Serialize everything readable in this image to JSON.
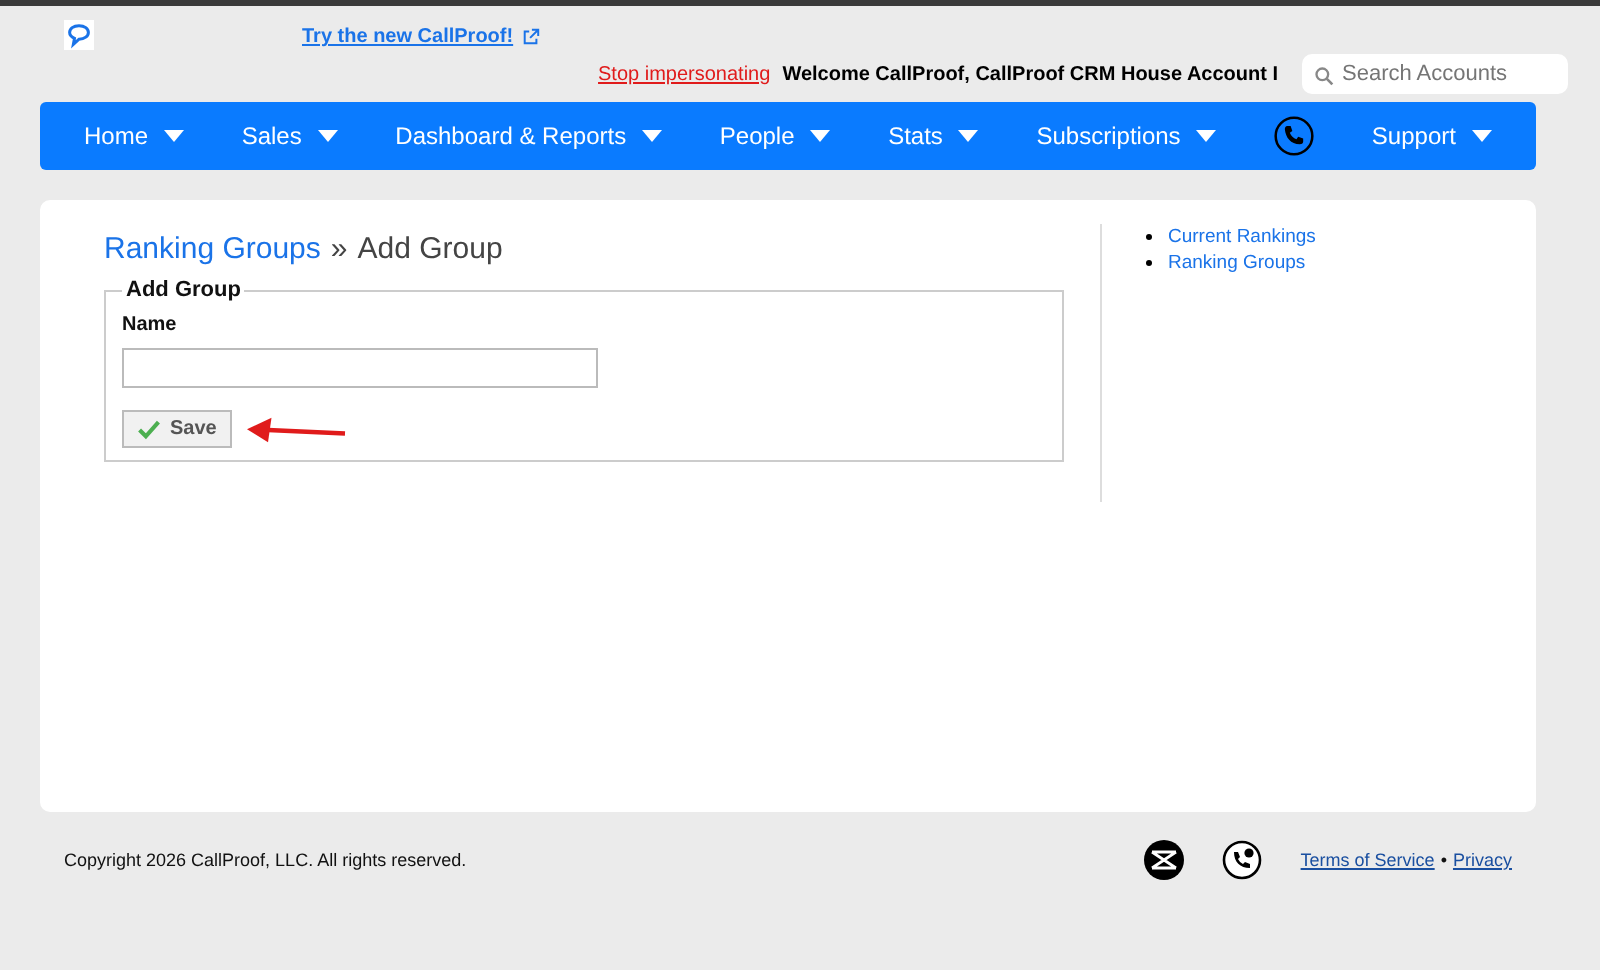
{
  "header": {
    "promo_link": "Try the new CallProof!",
    "stop_link": "Stop impersonating",
    "welcome": "Welcome CallProof, CallProof CRM House Account I",
    "search": {
      "placeholder": "Search Accounts"
    }
  },
  "nav": [
    {
      "label": "Home",
      "kind": "menu"
    },
    {
      "label": "Sales",
      "kind": "menu"
    },
    {
      "label": "Dashboard & Reports",
      "kind": "menu"
    },
    {
      "label": "People",
      "kind": "menu"
    },
    {
      "label": "Stats",
      "kind": "menu"
    },
    {
      "label": "Subscriptions",
      "kind": "menu"
    },
    {
      "kind": "phone"
    },
    {
      "label": "Support",
      "kind": "menu"
    }
  ],
  "breadcrumb": {
    "link": "Ranking Groups",
    "separator": "»",
    "current": "Add Group"
  },
  "form": {
    "legend": "Add Group",
    "name_label": "Name",
    "save_button": "Save"
  },
  "sidebar": {
    "links": [
      "Current Rankings",
      "Ranking Groups"
    ]
  },
  "footer": {
    "copyright": "Copyright 2026 CallProof, LLC. All rights reserved.",
    "links": [
      "Terms of Service",
      "Privacy"
    ],
    "separator": "•"
  }
}
